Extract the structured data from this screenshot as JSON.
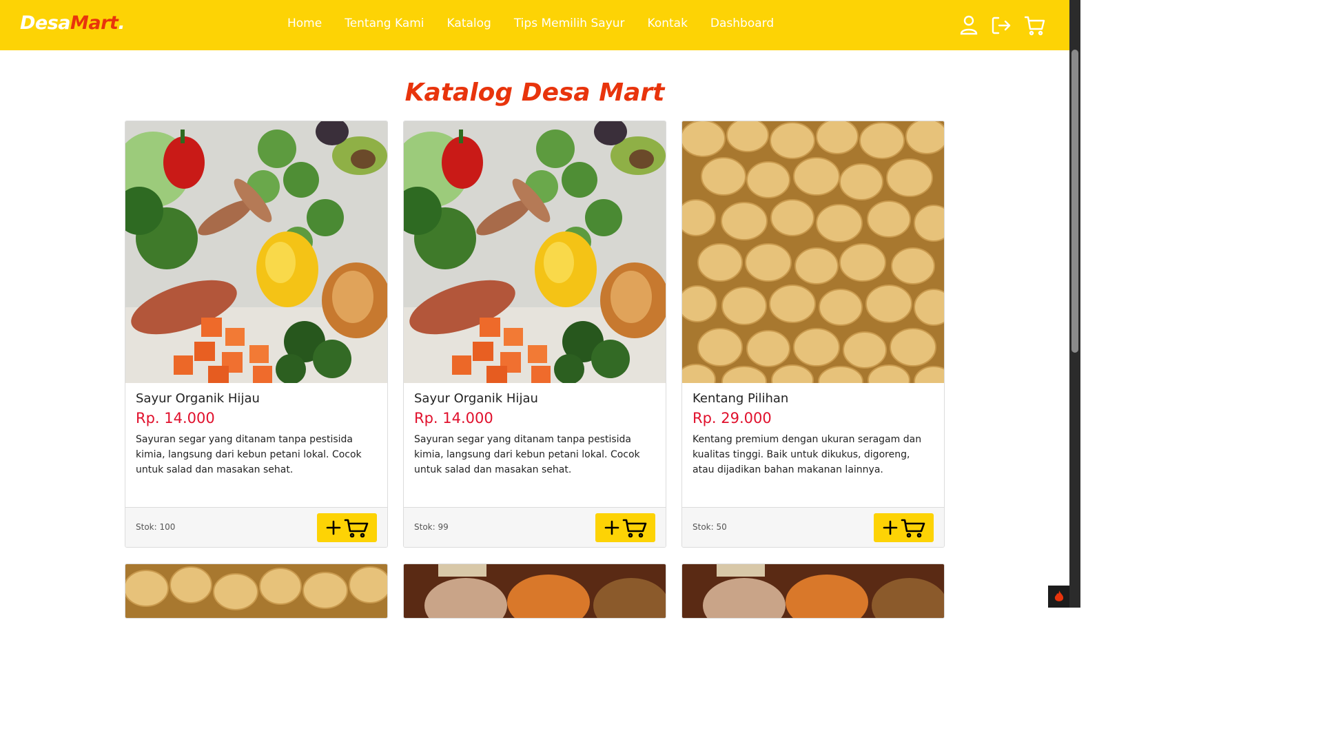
{
  "header": {
    "logo": {
      "part1": "Desa",
      "part2": "Mart",
      "part3": "."
    },
    "nav": [
      {
        "label": "Home"
      },
      {
        "label": "Tentang Kami"
      },
      {
        "label": "Katalog"
      },
      {
        "label": "Tips Memilih Sayur"
      },
      {
        "label": "Kontak"
      },
      {
        "label": "Dashboard"
      }
    ],
    "icons": [
      "user-icon",
      "logout-icon",
      "cart-icon"
    ]
  },
  "main": {
    "title": "Katalog Desa Mart",
    "products": [
      {
        "name": "Sayur Organik Hijau",
        "price": "Rp. 14.000",
        "description": "Sayuran segar yang ditanam tanpa pestisida kimia, langsung dari kebun petani lokal. Cocok untuk salad dan masakan sehat.",
        "stock": "Stok: 100",
        "image": "mixed-vegetables"
      },
      {
        "name": "Sayur Organik Hijau",
        "price": "Rp. 14.000",
        "description": "Sayuran segar yang ditanam tanpa pestisida kimia, langsung dari kebun petani lokal. Cocok untuk salad dan masakan sehat.",
        "stock": "Stok: 99",
        "image": "mixed-vegetables"
      },
      {
        "name": "Kentang Pilihan",
        "price": "Rp. 29.000",
        "description": "Kentang premium dengan ukuran seragam dan kualitas tinggi. Baik untuk dikukus, digoreng, atau dijadikan bahan makanan lainnya.",
        "stock": "Stok: 50",
        "image": "potatoes"
      }
    ],
    "next_row_images": [
      "potatoes",
      "baskets",
      "baskets"
    ]
  },
  "colors": {
    "header_bg": "#fdd305",
    "accent": "#e8340c",
    "price": "#e0102c",
    "button_bg": "#fdd305"
  }
}
